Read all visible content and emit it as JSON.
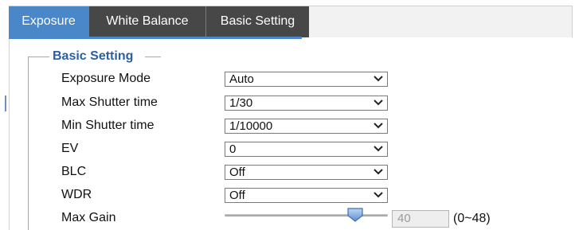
{
  "tabs": [
    {
      "label": "Exposure",
      "active": true
    },
    {
      "label": "White Balance",
      "active": false
    },
    {
      "label": "Basic Setting",
      "active": false
    }
  ],
  "section": {
    "legend": "Basic Setting"
  },
  "rows": [
    {
      "label": "Exposure Mode",
      "value": "Auto"
    },
    {
      "label": "Max Shutter time",
      "value": "1/30"
    },
    {
      "label": "Min Shutter time",
      "value": "1/10000"
    },
    {
      "label": "EV",
      "value": "0"
    },
    {
      "label": "BLC",
      "value": "Off"
    },
    {
      "label": "WDR",
      "value": "Off"
    }
  ],
  "max_gain": {
    "label": "Max Gain",
    "value": "40",
    "range_text": "(0~48)",
    "min": 0,
    "max": 48,
    "level": 40
  },
  "colors": {
    "active_tab": "#4a87c8",
    "inactive_tab": "#474747",
    "legend_text": "#2d5fa0",
    "slider_handle": "#6d9bd6"
  },
  "icons": {
    "dropdown": "chevron-down-icon",
    "slider_handle": "slider-handle-icon"
  }
}
